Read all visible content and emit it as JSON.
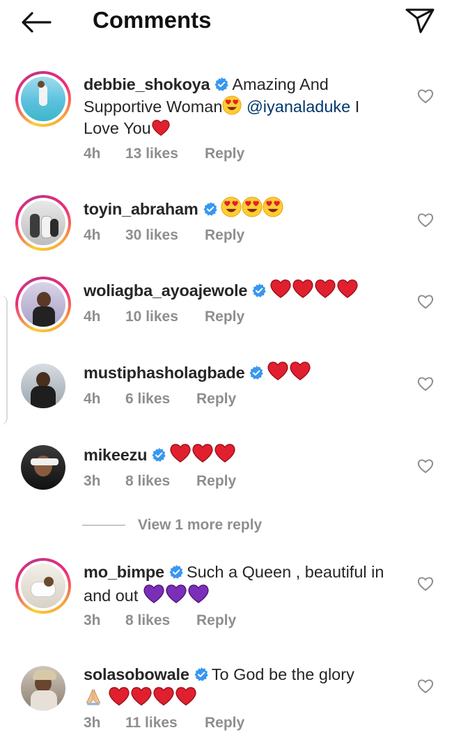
{
  "header": {
    "title": "Comments"
  },
  "colors": {
    "verified": "#3897f0",
    "heart": "#e0202e",
    "purple": "#7b2fb8",
    "mention": "#00376b"
  },
  "comments": [
    {
      "username": "debbie_shokoya",
      "text1": "Amazing And Supportive Woman",
      "mention": "@iyanaladuke",
      "text2": " I Love You",
      "time": "4h",
      "likes": "13 likes",
      "reply": "Reply"
    },
    {
      "username": "toyin_abraham",
      "time": "4h",
      "likes": "30 likes",
      "reply": "Reply"
    },
    {
      "username": "woliagba_ayoajewole",
      "time": "4h",
      "likes": "10 likes",
      "reply": "Reply"
    },
    {
      "username": "mustiphasholagbade",
      "time": "4h",
      "likes": "6 likes",
      "reply": "Reply"
    },
    {
      "username": "mikeezu",
      "time": "3h",
      "likes": "8 likes",
      "reply": "Reply"
    },
    {
      "username": "mo_bimpe",
      "text1": "Such a Queen , beautiful in and out",
      "time": "3h",
      "likes": "8 likes",
      "reply": "Reply"
    },
    {
      "username": "solasobowale",
      "text1": "To God be the glory",
      "time": "3h",
      "likes": "11 likes",
      "reply": "Reply"
    }
  ],
  "view_more": "View 1 more reply",
  "icons": [
    "back-arrow-icon",
    "direct-share-icon",
    "verified-icon",
    "like-heart-icon",
    "heart-eyes-emoji",
    "red-heart-emoji",
    "purple-heart-emoji",
    "folded-hands-emoji"
  ]
}
